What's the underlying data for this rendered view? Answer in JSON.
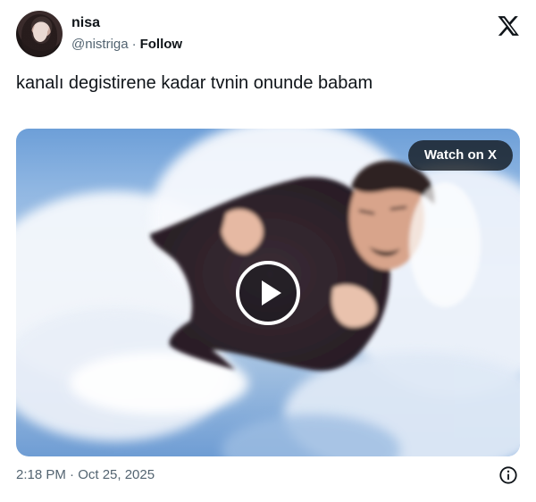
{
  "author": {
    "display_name": "nisa",
    "handle": "@nistriga",
    "separator": "·",
    "follow_label": "Follow",
    "avatar_icon": "profile-photo"
  },
  "tweet": {
    "text": "kanalı degistirene kadar tvnin onunde babam"
  },
  "media": {
    "type": "video",
    "watch_label": "Watch on X",
    "play_icon": "play-icon"
  },
  "footer": {
    "timestamp": "2:18 PM · Oct 25, 2025",
    "info_icon": "info-icon"
  },
  "brand": {
    "logo_icon": "x-logo-icon",
    "text_color": "#0f1419",
    "secondary_color": "#536471"
  }
}
